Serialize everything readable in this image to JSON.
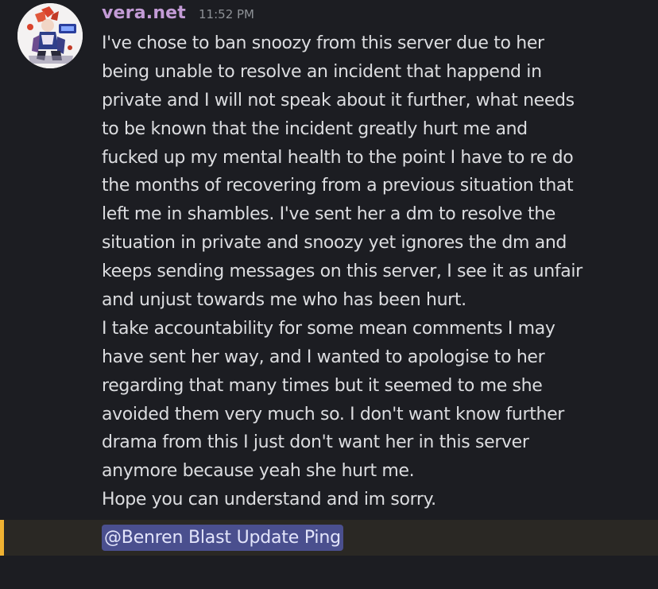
{
  "message": {
    "author": "vera.net",
    "timestamp": "11:52 PM",
    "avatar": "avatar-image",
    "lines": [
      "I've chose to ban snoozy from this server due to her",
      "being unable to resolve an incident that happend in",
      "private and I will not speak about it further, what needs",
      "to be known that the incident greatly hurt me and",
      "fucked up my mental health to the point I have to re do",
      "the months of recovering from a previous situation that",
      "left me in shambles. I've sent her a dm to resolve the",
      "situation in private and snoozy yet ignores the dm and",
      "keeps sending messages on this server, I see it as unfair",
      "and unjust towards me who has been hurt.",
      "I take accountability for some mean comments I may",
      "have sent her way, and I wanted to apologise to her",
      "regarding that many times but it seemed to me she",
      "avoided them very much so. I don't want know further",
      "drama from this I just don't want her in this server",
      "anymore because yeah she hurt me.",
      "Hope you can understand and im sorry."
    ],
    "mention": "@Benren Blast Update Ping"
  },
  "colors": {
    "background": "#1c1d22",
    "username": "#c39bd6",
    "mention_highlight_bar": "#f0b232",
    "mention_pill": "#4a4f8e"
  }
}
